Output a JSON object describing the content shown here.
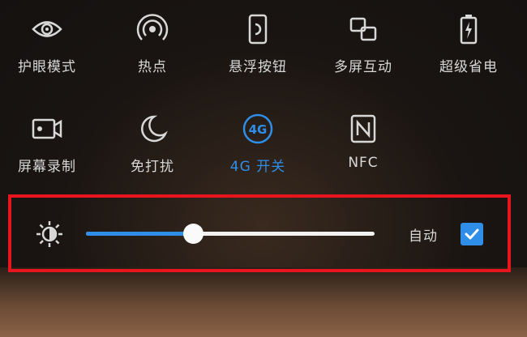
{
  "quick_settings": {
    "row1": [
      {
        "label": "护眼模式",
        "icon": "eye-icon"
      },
      {
        "label": "热点",
        "icon": "hotspot-icon"
      },
      {
        "label": "悬浮按钮",
        "icon": "floating-button-icon"
      },
      {
        "label": "多屏互动",
        "icon": "multi-screen-icon"
      },
      {
        "label": "超级省电",
        "icon": "battery-icon"
      }
    ],
    "row2": [
      {
        "label": "屏幕录制",
        "icon": "screen-record-icon"
      },
      {
        "label": "免打扰",
        "icon": "moon-icon"
      },
      {
        "label": "4G 开关",
        "icon": "4g-icon",
        "active": true
      },
      {
        "label": "NFC",
        "icon": "nfc-icon"
      }
    ]
  },
  "brightness": {
    "level": 0.37,
    "auto_label": "自动",
    "auto_checked": true,
    "icon": "brightness-icon"
  },
  "colors": {
    "accent": "#2f8fe8",
    "highlight_border": "#e8141e",
    "text": "#d8d8d8"
  }
}
